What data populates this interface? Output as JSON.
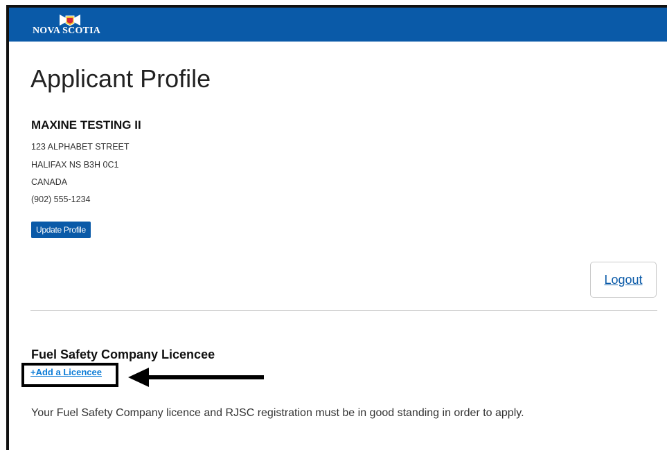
{
  "header": {
    "logo_text": "NOVA SCOTIA",
    "bar_color": "#0a5aa8"
  },
  "page": {
    "title": "Applicant Profile"
  },
  "profile": {
    "name": "MAXINE TESTING II",
    "address_lines": [
      "123 ALPHABET STREET",
      "HALIFAX NS B3H 0C1",
      "CANADA",
      "(902) 555-1234"
    ],
    "update_button_label": "Update Profile"
  },
  "actions": {
    "logout_label": "Logout"
  },
  "licencee": {
    "heading": "Fuel Safety Company Licencee",
    "add_link_label": "+Add a Licencee",
    "notice": "Your Fuel Safety Company licence and RJSC registration must be in good standing in order to apply."
  },
  "colors": {
    "accent": "#0a5aa8",
    "link": "#0a7bd6",
    "annotation": "#000000"
  },
  "icons": {
    "logo": "nova-scotia-flag-icon",
    "annotation_arrow": "left-arrow-icon"
  }
}
